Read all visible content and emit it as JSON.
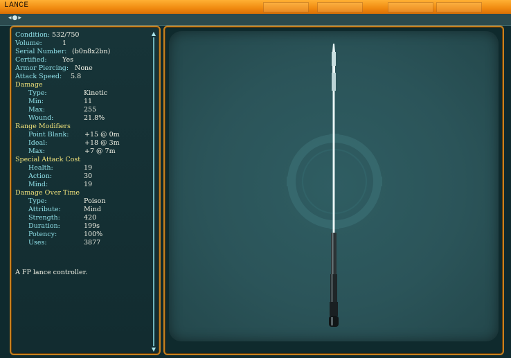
{
  "window": {
    "title": "LANCE"
  },
  "nav": {
    "arrows": "◂●▸"
  },
  "stats": [
    {
      "k": "Condition:",
      "v": "532/750",
      "vx": 53
    },
    {
      "k": "Volume:",
      "v": "1",
      "vx": 68
    },
    {
      "k": "Serial Number:",
      "v": "(b0n8x2bn)",
      "vx": 82
    },
    {
      "k": "Certified:",
      "v": "Yes",
      "vx": 68
    },
    {
      "k": "Armor Piercing:",
      "v": "None",
      "vx": 86
    },
    {
      "k": "Attack Speed:",
      "v": "5.8",
      "vx": 80
    },
    {
      "k": "Damage",
      "head": true
    },
    {
      "k": "Type:",
      "v": "Kinetic",
      "vx": 99,
      "sub": true
    },
    {
      "k": "Min:",
      "v": "11",
      "vx": 99,
      "sub": true
    },
    {
      "k": "Max:",
      "v": "255",
      "vx": 99,
      "sub": true
    },
    {
      "k": "Wound:",
      "v": "21.8%",
      "vx": 99,
      "sub": true
    },
    {
      "k": "Range Modifiers",
      "head": true
    },
    {
      "k": "Point Blank:",
      "v": "+15 @ 0m",
      "vx": 100,
      "sub": true
    },
    {
      "k": "Ideal:",
      "v": "+18 @ 3m",
      "vx": 100,
      "sub": true
    },
    {
      "k": "Max:",
      "v": "+7 @ 7m",
      "vx": 100,
      "sub": true
    },
    {
      "k": "Special Attack Cost",
      "head": true
    },
    {
      "k": "Health:",
      "v": "19",
      "vx": 99,
      "sub": true
    },
    {
      "k": "Action:",
      "v": "30",
      "vx": 99,
      "sub": true
    },
    {
      "k": "Mind:",
      "v": "19",
      "vx": 99,
      "sub": true
    },
    {
      "k": "Damage Over Time",
      "head": true
    },
    {
      "k": "Type:",
      "v": "Poison",
      "vx": 99,
      "sub": true
    },
    {
      "k": "Attribute:",
      "v": "Mind",
      "vx": 99,
      "sub": true
    },
    {
      "k": "Strength:",
      "v": "420",
      "vx": 99,
      "sub": true
    },
    {
      "k": "Duration:",
      "v": "199s",
      "vx": 99,
      "sub": true
    },
    {
      "k": "Potency:",
      "v": "100%",
      "vx": 99,
      "sub": true
    },
    {
      "k": "Uses:",
      "v": "3877",
      "vx": 99,
      "sub": true
    }
  ],
  "description": "A FP lance controller.",
  "scroll": {
    "up": "▲",
    "down": "▼"
  },
  "colors": {
    "accent": "#c7801e",
    "label": "#8fe0e8",
    "heading": "#f0e27a",
    "value": "#f2f2e6"
  }
}
